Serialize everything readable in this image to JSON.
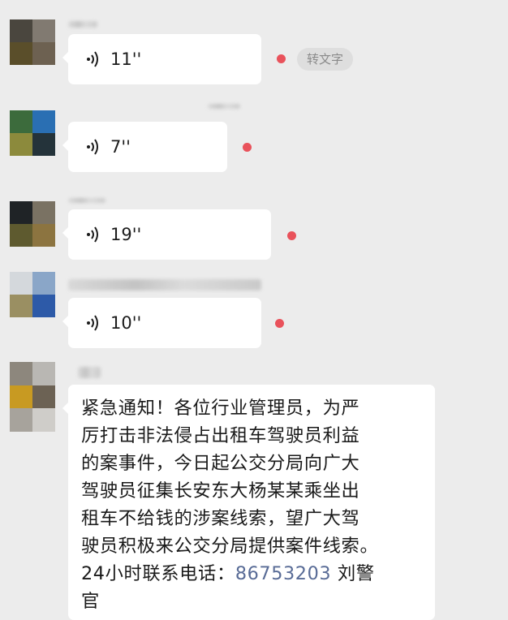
{
  "colors": {
    "background": "#ececec",
    "bubble": "#ffffff",
    "unread_dot": "#e9525b",
    "phone_link": "#586b96"
  },
  "icons": {
    "voice": "voice-wave-icon",
    "unread": "unread-dot"
  },
  "voice_messages": [
    {
      "duration": "11''"
    },
    {
      "duration": "7''"
    },
    {
      "duration": "19''"
    },
    {
      "duration": "10''"
    }
  ],
  "to_text_label": "转文字",
  "text_message": {
    "lines": [
      "紧急通知！各位行业管理员，为严",
      "厉打击非法侵占出租车驾驶员利益",
      "的案事件，今日起公交分局向广大",
      "驾驶员征集长安东大杨某某乘坐出",
      "租车不给钱的涉案线索，望广大驾",
      "驶员积极来公交分局提供案件线索。"
    ],
    "last_line_prefix": "24小时联系电话：",
    "phone": "86753203",
    "last_line_suffix": " 刘警",
    "overflow_line": "官"
  }
}
